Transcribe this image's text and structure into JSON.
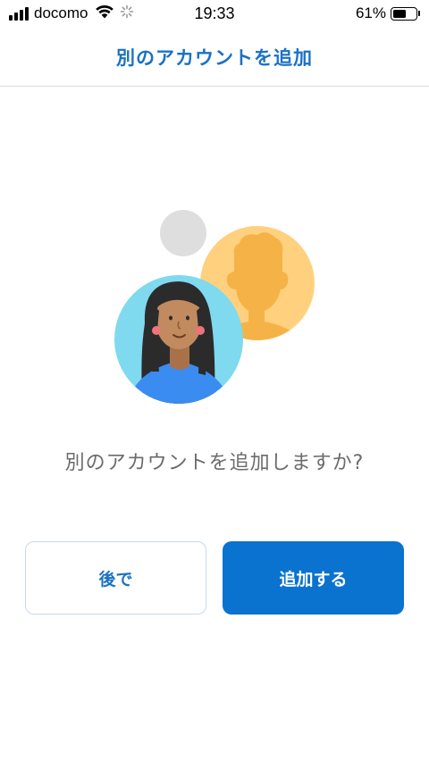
{
  "status_bar": {
    "carrier": "docomo",
    "time": "19:33",
    "battery_percent": "61%",
    "battery_level": 0.61,
    "icons": [
      "signal-icon",
      "wifi-icon",
      "loading-icon",
      "battery-icon"
    ]
  },
  "header": {
    "title": "別のアカウントを追加"
  },
  "main": {
    "illustration": "account-avatars-illustration",
    "prompt": "別のアカウントを追加しますか?"
  },
  "actions": {
    "later_label": "後で",
    "add_label": "追加する"
  },
  "colors": {
    "accent": "#1a72c4",
    "primary_button": "#0a72cf",
    "avatar_front_bg": "#7fd9ef",
    "avatar_back_bg": "#ffd17f",
    "avatar_back_silhouette": "#f5b347",
    "dot_gray": "#dedede"
  }
}
